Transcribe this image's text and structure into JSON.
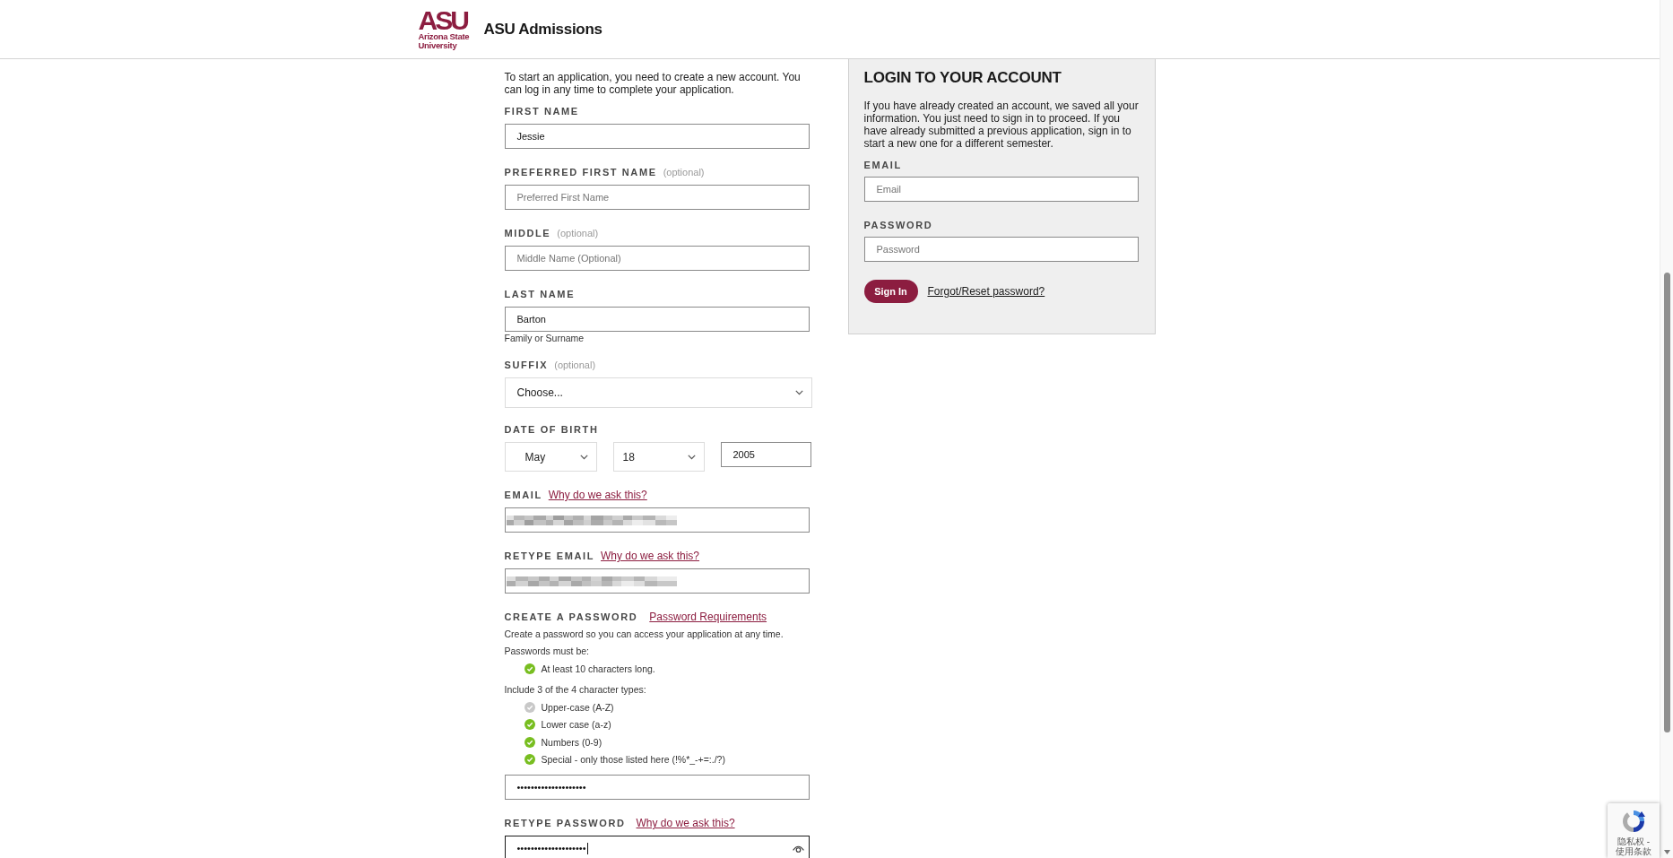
{
  "header": {
    "logo": {
      "mark": "ASU",
      "lines": [
        "Arizona State",
        "University"
      ]
    },
    "title": "ASU Admissions"
  },
  "create_account": {
    "intro": "To start an application, you need to create a new account. You can log in any time to complete your application.",
    "fields": [
      {
        "kind": "input",
        "label": "FIRST NAME",
        "value": "Jessie"
      },
      {
        "kind": "input",
        "label": "PREFERRED FIRST NAME",
        "optional": "(optional)",
        "placeholder": "Preferred First Name"
      },
      {
        "kind": "input",
        "label": "MIDDLE",
        "optional": "(optional)",
        "placeholder": "Middle Name (Optional)"
      },
      {
        "kind": "input",
        "label": "LAST NAME",
        "value": "Barton",
        "hint": "Family or Surname"
      },
      {
        "kind": "select",
        "label": "SUFFIX",
        "optional": "(optional)",
        "value": "Choose..."
      },
      {
        "kind": "date",
        "label": "DATE OF BIRTH",
        "month": "May",
        "day": "18",
        "year": "2005"
      },
      {
        "kind": "input",
        "label": "EMAIL",
        "link": "Why do we ask this?",
        "redacted": true
      },
      {
        "kind": "input",
        "label": "RETYPE EMAIL",
        "link": "Why do we ask this?",
        "redacted": true
      },
      {
        "kind": "password",
        "label": "CREATE A PASSWORD",
        "link": "Password Requirements",
        "help": "Create a password so you can access your application at any time.",
        "groups": [
          {
            "title": "Passwords must be:",
            "rules": [
              {
                "text": "At least 10 characters long.",
                "met": true
              }
            ]
          },
          {
            "title": "Include 3 of the 4 character types:",
            "rules": [
              {
                "text": "Upper-case (A-Z)",
                "met": false
              },
              {
                "text": "Lower case (a-z)",
                "met": true
              },
              {
                "text": "Numbers (0-9)",
                "met": true
              },
              {
                "text": "Special - only those listed here (!%*_-+=:./?)",
                "met": true
              }
            ]
          }
        ],
        "value": "••••••••••••••••••••"
      },
      {
        "kind": "input",
        "label": "RETYPE PASSWORD",
        "link": "Why do we ask this?",
        "value": "••••••••••••••••••••",
        "focused": true,
        "reveal": true
      }
    ]
  },
  "login": {
    "title": "LOGIN TO YOUR ACCOUNT",
    "text": "If you have already created an account, we saved all your information. You just need to sign in to proceed. If you have already submitted a previous application, sign in to start a new one for a different semester.",
    "fields": [
      {
        "label": "EMAIL",
        "placeholder": "Email"
      },
      {
        "label": "PASSWORD",
        "placeholder": "Password"
      }
    ],
    "button": "Sign In",
    "link": "Forgot/Reset password?"
  },
  "recaptcha": {
    "text": "隐私权 - 使用条款"
  }
}
